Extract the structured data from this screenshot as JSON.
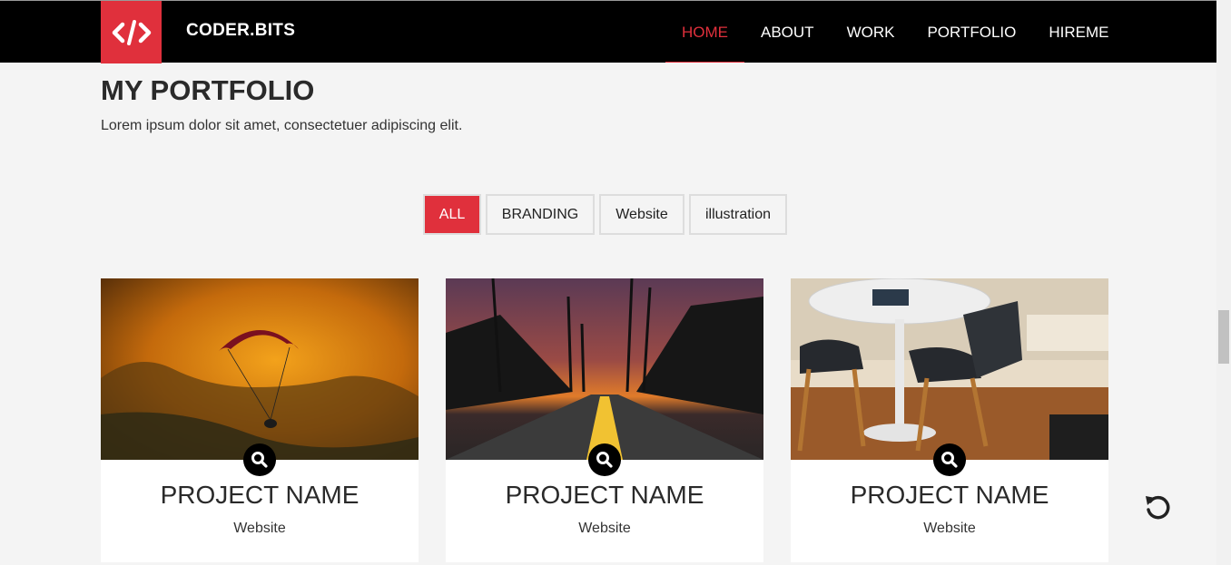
{
  "brand": {
    "name": "CODER.BITS",
    "logo_icon": "code-slash-icon",
    "accent": "#e0303c"
  },
  "nav": {
    "items": [
      {
        "label": "HOME",
        "active": true
      },
      {
        "label": "ABOUT",
        "active": false
      },
      {
        "label": "WORK",
        "active": false
      },
      {
        "label": "PORTFOLIO",
        "active": false
      },
      {
        "label": "HIREME",
        "active": false
      }
    ]
  },
  "section": {
    "title": "MY PORTFOLIO",
    "subtitle": "Lorem ipsum dolor sit amet, consectetuer adipiscing elit."
  },
  "filters": [
    {
      "label": "ALL",
      "active": true
    },
    {
      "label": "BRANDING",
      "active": false
    },
    {
      "label": "Website",
      "active": false
    },
    {
      "label": "illustration",
      "active": false
    }
  ],
  "projects": [
    {
      "title": "PROJECT NAME",
      "category": "Website",
      "image": "paraglider-sunset"
    },
    {
      "title": "PROJECT NAME",
      "category": "Website",
      "image": "palm-road-sunset"
    },
    {
      "title": "PROJECT NAME",
      "category": "Website",
      "image": "table-and-chairs"
    }
  ],
  "icons": {
    "zoom": "search-icon",
    "refresh": "refresh-icon"
  }
}
